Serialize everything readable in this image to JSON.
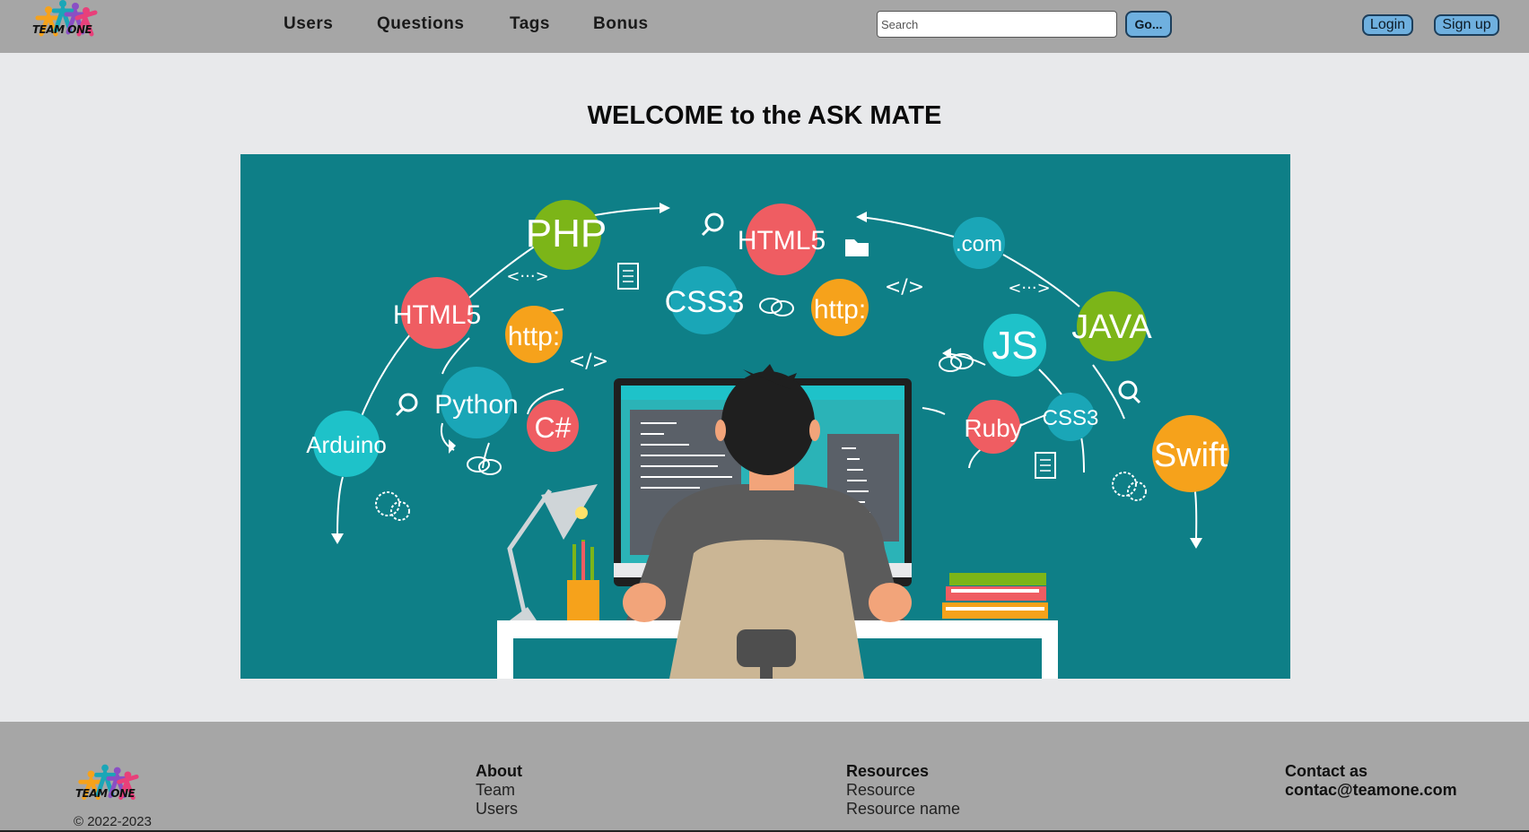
{
  "header": {
    "logo_text": "TEAM ONE",
    "nav": [
      "Users",
      "Questions",
      "Tags",
      "Bonus"
    ],
    "search": {
      "placeholder": "Search",
      "value": "",
      "button_label": "Go..."
    },
    "auth": {
      "login_label": "Login",
      "signup_label": "Sign up"
    }
  },
  "main": {
    "title": "WELCOME to the ASK MATE",
    "hero_labels": {
      "php": "PHP",
      "html5_left": "HTML5",
      "html5_center": "HTML5",
      "css3_center": "CSS3",
      "http_left": "http:",
      "http_center": "http:",
      "com": ".com",
      "js": "JS",
      "java": "JAVA",
      "python": "Python",
      "csharp": "C#",
      "arduino": "Arduino",
      "ruby": "Ruby",
      "css3_right": "CSS3",
      "swift": "Swift",
      "code_tag": "</>",
      "dots_tag": "<···>"
    }
  },
  "footer": {
    "logo_text": "TEAM ONE",
    "copyright": "© 2022-2023",
    "about": {
      "heading": "About",
      "links": [
        "Team",
        "Users"
      ]
    },
    "resources": {
      "heading": "Resources",
      "links": [
        "Resource",
        "Resource name"
      ]
    },
    "contact": {
      "heading": "Contact as",
      "email": "contac@teamone.com"
    }
  },
  "colors": {
    "header_bg": "#a6a6a6",
    "page_bg": "#e8e9eb",
    "hero_bg": "#0e7f87",
    "button_bg": "#6fb0df",
    "green": "#7cb518",
    "red": "#ef5d62",
    "orange": "#f6a21b",
    "teal": "#1aa6b7"
  }
}
